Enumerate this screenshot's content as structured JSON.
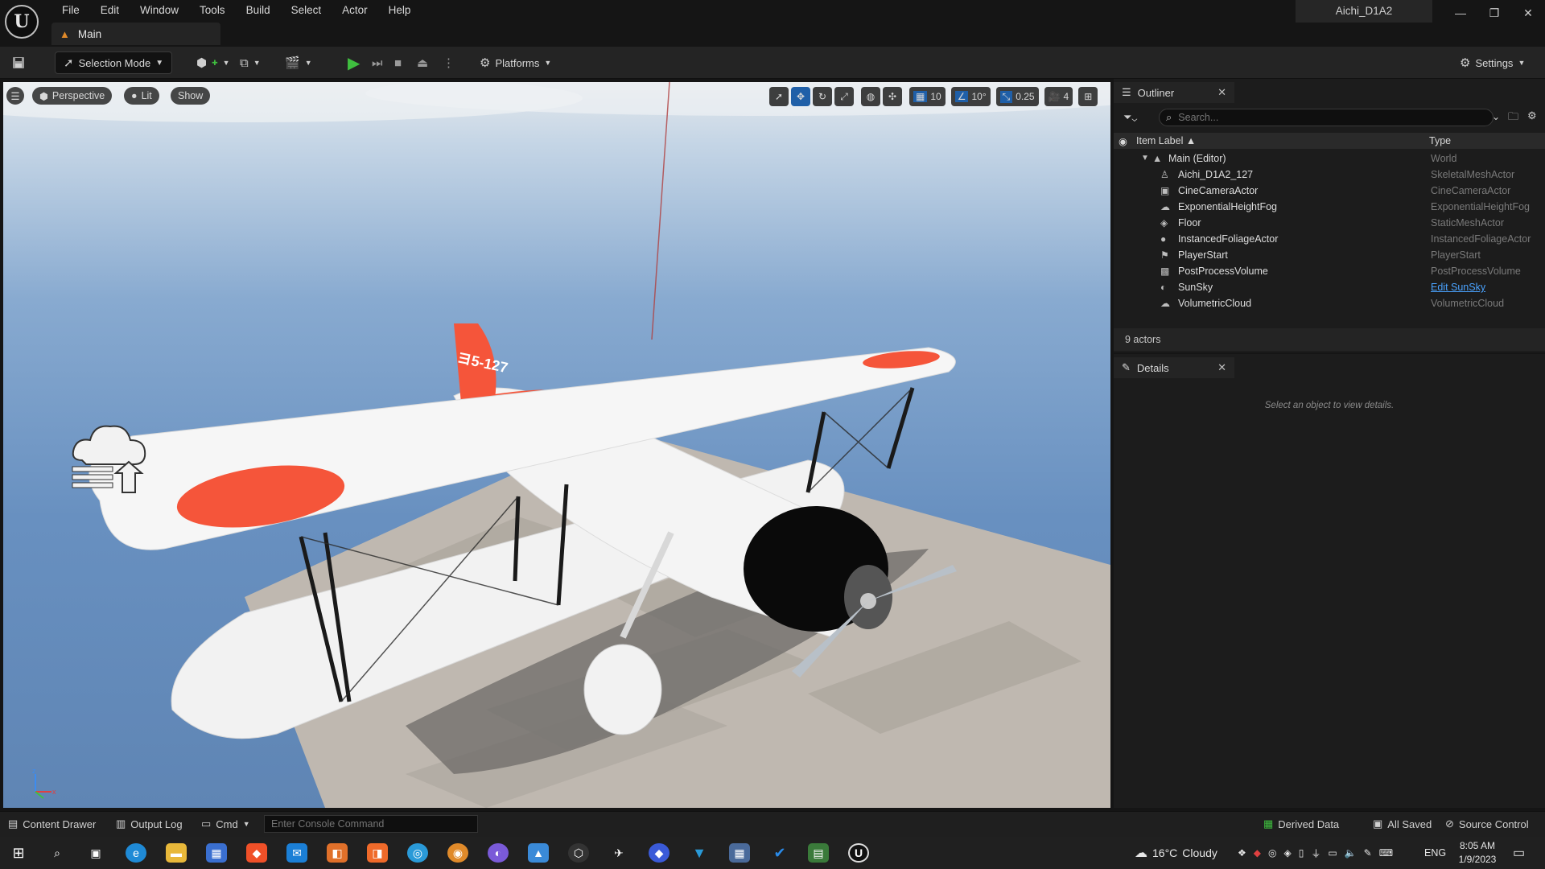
{
  "menu": [
    "File",
    "Edit",
    "Window",
    "Tools",
    "Build",
    "Select",
    "Actor",
    "Help"
  ],
  "level_tab": "Main",
  "project_name": "Aichi_D1A2",
  "toolbar": {
    "selection_mode": "Selection Mode",
    "platforms": "Platforms",
    "settings": "Settings"
  },
  "viewport": {
    "perspective": "Perspective",
    "lit": "Lit",
    "show": "Show",
    "grid_snap": "10",
    "rotation_snap": "10°",
    "scale_snap": "0.25",
    "camera_speed": "4",
    "aircraft_marking": "ヨ5-127"
  },
  "outliner": {
    "title": "Outliner",
    "search_placeholder": "Search...",
    "col_label": "Item Label",
    "col_type": "Type",
    "root": {
      "label": "Main (Editor)",
      "type": "World"
    },
    "rows": [
      {
        "label": "Aichi_D1A2_127",
        "type": "SkeletalMeshActor",
        "icon": "skeletal-icon"
      },
      {
        "label": "CineCameraActor",
        "type": "CineCameraActor",
        "icon": "camera-icon"
      },
      {
        "label": "ExponentialHeightFog",
        "type": "ExponentialHeightFog",
        "icon": "fog-icon"
      },
      {
        "label": "Floor",
        "type": "StaticMeshActor",
        "icon": "mesh-icon"
      },
      {
        "label": "InstancedFoliageActor",
        "type": "InstancedFoliageActor",
        "icon": "foliage-icon"
      },
      {
        "label": "PlayerStart",
        "type": "PlayerStart",
        "icon": "flag-icon"
      },
      {
        "label": "PostProcessVolume",
        "type": "PostProcessVolume",
        "icon": "volume-icon"
      },
      {
        "label": "SunSky",
        "type": "Edit SunSky",
        "icon": "sun-icon"
      },
      {
        "label": "VolumetricCloud",
        "type": "VolumetricCloud",
        "icon": "cloud-icon"
      }
    ],
    "count": "9 actors"
  },
  "details": {
    "title": "Details",
    "hint": "Select an object to view details."
  },
  "bottombar": {
    "content_drawer": "Content Drawer",
    "output_log": "Output Log",
    "cmd": "Cmd",
    "console_placeholder": "Enter Console Command",
    "derived_data": "Derived Data",
    "all_saved": "All Saved",
    "source_control": "Source Control"
  },
  "taskbar": {
    "weather_temp": "16°C",
    "weather_desc": "Cloudy",
    "lang": "ENG",
    "time": "8:05 AM",
    "date": "1/9/2023"
  },
  "colors": {
    "accent_blue": "#1f5fa8",
    "play_green": "#3fbf3f",
    "roundel_red": "#f5553a",
    "link_blue": "#4aa3ff"
  }
}
